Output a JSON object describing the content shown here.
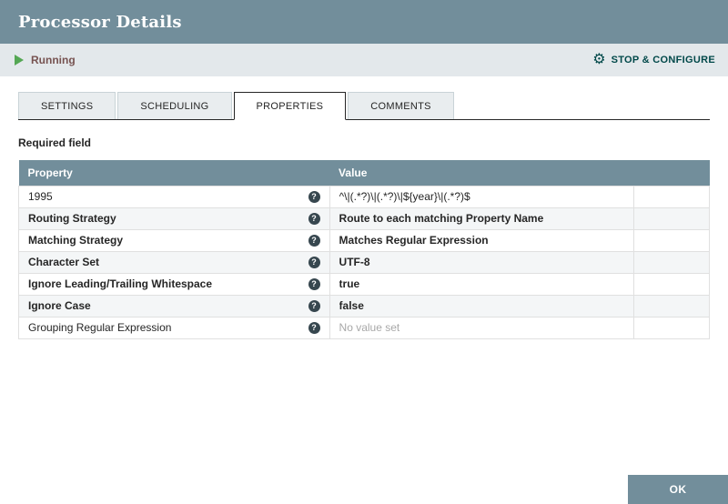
{
  "header": {
    "title": "Processor Details"
  },
  "status_bar": {
    "state_label": "Running",
    "action_label": "STOP & CONFIGURE"
  },
  "tabs": [
    {
      "label": "SETTINGS",
      "active": false
    },
    {
      "label": "SCHEDULING",
      "active": false
    },
    {
      "label": "PROPERTIES",
      "active": true
    },
    {
      "label": "COMMENTS",
      "active": false
    }
  ],
  "properties_tab": {
    "required_field_label": "Required field",
    "table": {
      "columns": {
        "property": "Property",
        "value": "Value"
      },
      "rows": [
        {
          "property": "1995",
          "value": "^\\|(.*?)\\|(.*?)\\|${year}\\|(.*?)$",
          "bold": false,
          "placeholder": false
        },
        {
          "property": "Routing Strategy",
          "value": "Route to each matching Property Name",
          "bold": true,
          "placeholder": false
        },
        {
          "property": "Matching Strategy",
          "value": "Matches Regular Expression",
          "bold": true,
          "placeholder": false
        },
        {
          "property": "Character Set",
          "value": "UTF-8",
          "bold": true,
          "placeholder": false
        },
        {
          "property": "Ignore Leading/Trailing Whitespace",
          "value": "true",
          "bold": true,
          "placeholder": false
        },
        {
          "property": "Ignore Case",
          "value": "false",
          "bold": true,
          "placeholder": false
        },
        {
          "property": "Grouping Regular Expression",
          "value": "No value set",
          "bold": false,
          "placeholder": true
        }
      ]
    }
  },
  "footer": {
    "ok_label": "OK"
  },
  "icons": {
    "running_state": "play-triangle",
    "stop_configure": "gear",
    "help": "question-circle"
  },
  "colors": {
    "header_bg": "#728e9b",
    "status_bar_bg": "#e3e8eb",
    "action_text": "#004849",
    "running_green": "#54a754",
    "table_header_bg": "#728e9b",
    "alt_row_bg": "#f4f6f7",
    "placeholder_text": "#a8a8a8"
  }
}
